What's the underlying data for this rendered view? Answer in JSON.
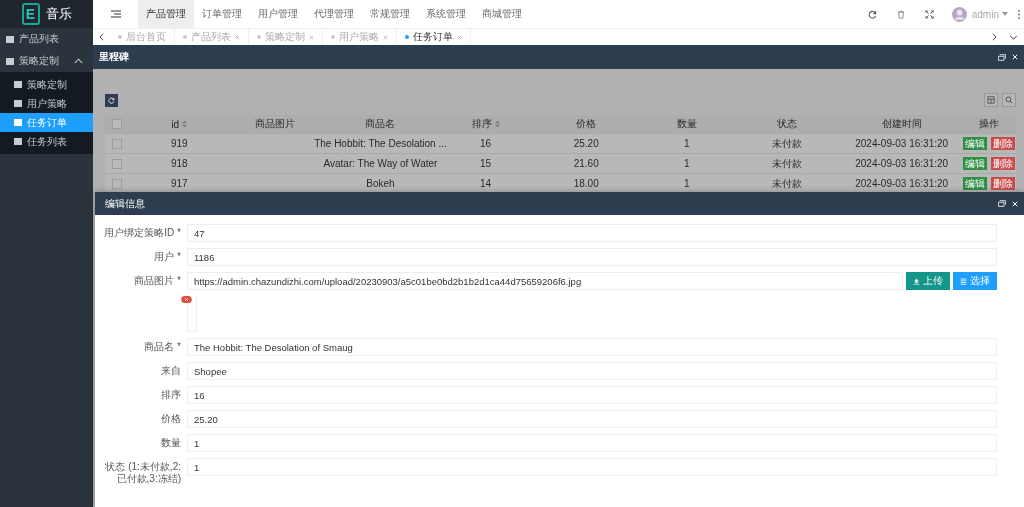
{
  "logo": {
    "mark": "E",
    "title": "音乐"
  },
  "sidebar": {
    "items": [
      {
        "label": "产品列表",
        "selected": false
      },
      {
        "label": "策略定制",
        "selected": false,
        "expanded": true,
        "children": [
          {
            "label": "策略定制",
            "selected": false
          },
          {
            "label": "用户策略",
            "selected": false
          },
          {
            "label": "任务订单",
            "selected": true
          },
          {
            "label": "任务列表",
            "selected": false
          }
        ]
      }
    ]
  },
  "top_nav": {
    "items": [
      {
        "label": "产品管理",
        "selected": true
      },
      {
        "label": "订单管理",
        "selected": false
      },
      {
        "label": "用户管理",
        "selected": false
      },
      {
        "label": "代理管理",
        "selected": false
      },
      {
        "label": "常规管理",
        "selected": false
      },
      {
        "label": "系统管理",
        "selected": false
      },
      {
        "label": "商城管理",
        "selected": false
      }
    ],
    "user": "admin"
  },
  "tabs": [
    {
      "label": "后台首页",
      "selected": false,
      "closable": false
    },
    {
      "label": "产品列表",
      "selected": false,
      "closable": true
    },
    {
      "label": "策略定制",
      "selected": false,
      "closable": true
    },
    {
      "label": "用户策略",
      "selected": false,
      "closable": true
    },
    {
      "label": "任务订单",
      "selected": true,
      "closable": true
    }
  ],
  "panel": {
    "title": "里程碑"
  },
  "table": {
    "all_checked": false,
    "columns": [
      {
        "label": "id",
        "sortable": true
      },
      {
        "label": "商品图片",
        "sortable": false
      },
      {
        "label": "商品名",
        "sortable": false
      },
      {
        "label": "排序",
        "sortable": true
      },
      {
        "label": "价格",
        "sortable": false
      },
      {
        "label": "数量",
        "sortable": false
      },
      {
        "label": "状态",
        "sortable": false
      },
      {
        "label": "创建时间",
        "sortable": false
      },
      {
        "label": "操作",
        "sortable": false
      }
    ],
    "rows": [
      {
        "checked": false,
        "cells": [
          "919",
          "",
          "The Hobbit: The Desolation ...",
          "16",
          "25.20",
          "1",
          "未付款",
          "2024-09-03 16:31:20"
        ],
        "actions": [
          "编辑",
          "删除"
        ]
      },
      {
        "checked": false,
        "cells": [
          "918",
          "",
          "Avatar: The Way of Water",
          "15",
          "21.60",
          "1",
          "未付款",
          "2024-09-03 16:31:20"
        ],
        "actions": [
          "编辑",
          "删除"
        ]
      },
      {
        "checked": false,
        "cells": [
          "917",
          "",
          "Bokeh",
          "14",
          "18.00",
          "1",
          "未付款",
          "2024-09-03 16:31:20"
        ],
        "actions": [
          "编辑",
          "删除"
        ]
      }
    ]
  },
  "dialog": {
    "title": "编辑信息",
    "fields": [
      {
        "kind": "text",
        "label": "用户绑定策略ID *",
        "value": "47"
      },
      {
        "kind": "text",
        "label": "用户 *",
        "value": "1186"
      },
      {
        "kind": "image",
        "label": "商品图片 *",
        "value": "https://admin.chazundizhi.com/upload/20230903/a5c01be0bd2b1b2d1ca44d75659206f6.jpg",
        "buttons": [
          "上传",
          "选择"
        ]
      },
      {
        "kind": "text",
        "label": "商品名 *",
        "value": "The Hobbit: The Desolation of Smaug"
      },
      {
        "kind": "text",
        "label": "来自",
        "value": "Shopee"
      },
      {
        "kind": "text",
        "label": "排序",
        "value": "16"
      },
      {
        "kind": "text",
        "label": "价格",
        "value": "25.20"
      },
      {
        "kind": "text",
        "label": "数量",
        "value": "1"
      },
      {
        "kind": "text",
        "label": "状态 (1:未付款,2:已付款,3:冻结)",
        "value": "1"
      }
    ]
  }
}
